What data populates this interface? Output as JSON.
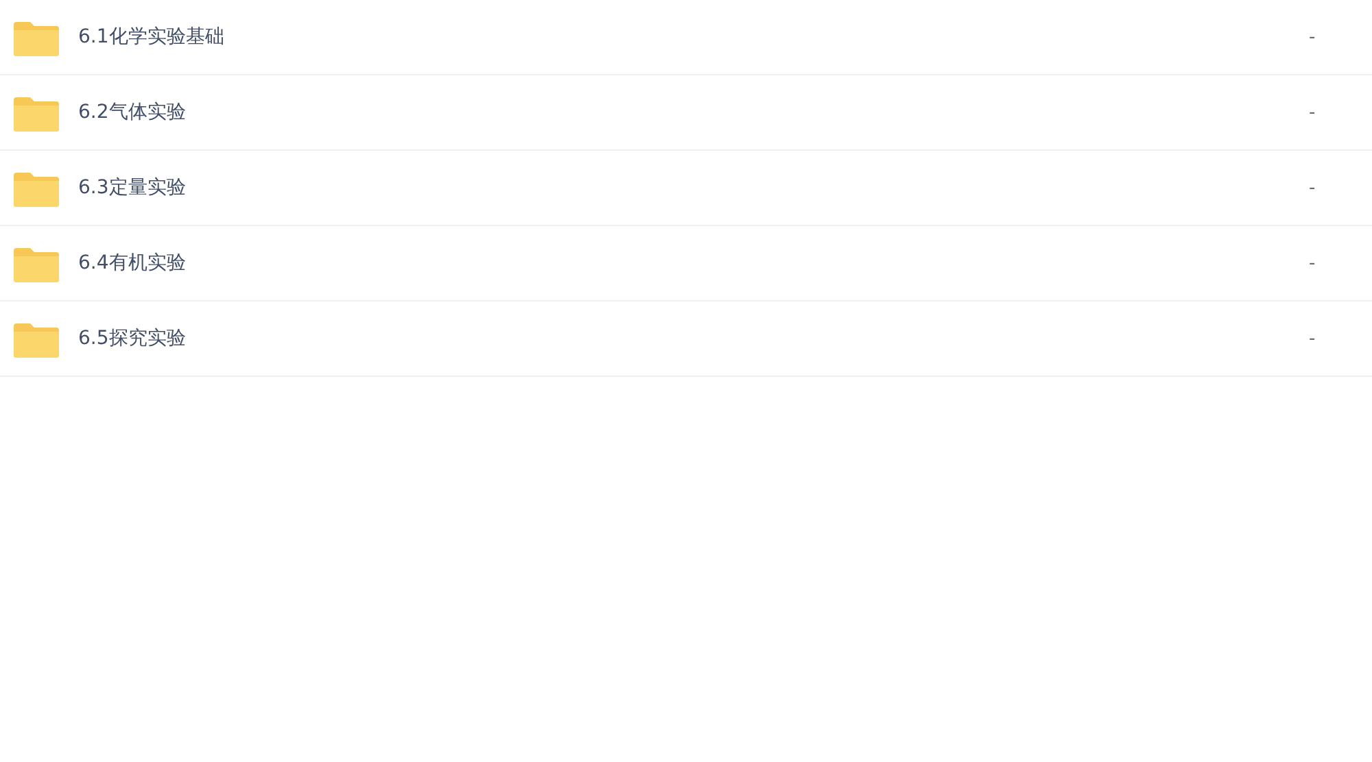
{
  "files": [
    {
      "name": "6.1化学实验基础",
      "size": "-"
    },
    {
      "name": "6.2气体实验",
      "size": "-"
    },
    {
      "name": "6.3定量实验",
      "size": "-"
    },
    {
      "name": "6.4有机实验",
      "size": "-"
    },
    {
      "name": "6.5探究实验",
      "size": "-"
    }
  ]
}
